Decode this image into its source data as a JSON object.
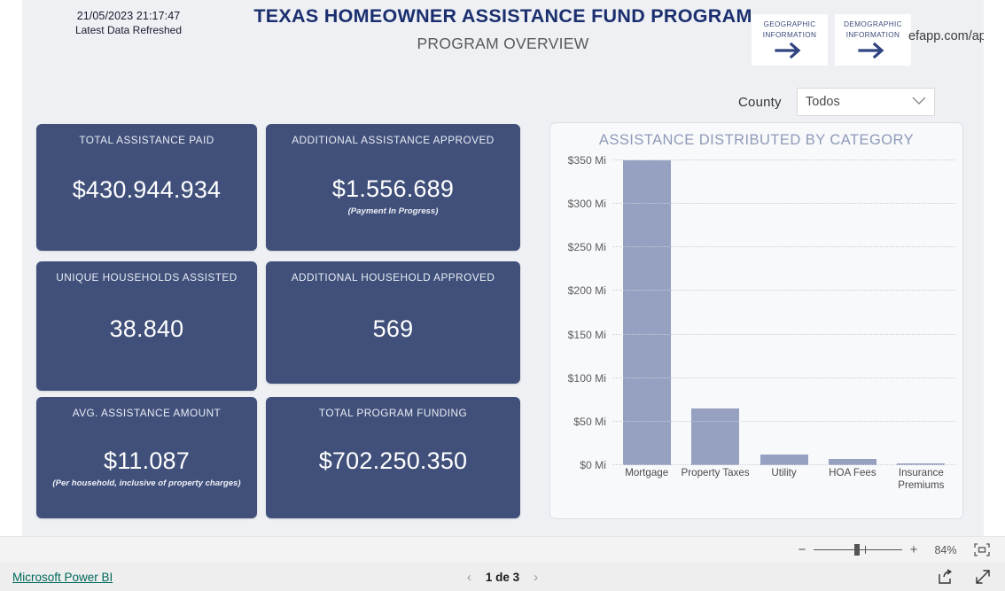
{
  "header": {
    "refresh_time": "21/05/2023 21:17:47",
    "refresh_label": "Latest Data Refreshed",
    "title": "TEXAS HOMEOWNER ASSISTANCE FUND PROGRAM",
    "subtitle": "PROGRAM OVERVIEW",
    "nav_buttons": [
      {
        "line1": "GEOGRAPHIC",
        "line2": "INFORMATION",
        "arrow": "→"
      },
      {
        "line1": "DEMOGRAPHIC",
        "line2": "INFORMATION",
        "arrow": "→"
      }
    ],
    "clipped_url": "efapp.com/ap"
  },
  "slicer": {
    "label": "County",
    "value": "Todos",
    "chevron": "⌄"
  },
  "cards": [
    {
      "title": "TOTAL ASSISTANCE PAID",
      "value": "$430.944.934",
      "note": ""
    },
    {
      "title": "ADDITIONAL ASSISTANCE APPROVED",
      "value": "$1.556.689",
      "note": "(Payment In Progress)"
    },
    {
      "title": "UNIQUE HOUSEHOLDS ASSISTED",
      "value": "38.840",
      "note": ""
    },
    {
      "title": "ADDITIONAL HOUSEHOLD APPROVED",
      "value": "569",
      "note": ""
    },
    {
      "title": "AVG. ASSISTANCE AMOUNT",
      "value": "$11.087",
      "note": "(Per household, inclusive of property charges)"
    },
    {
      "title": "TOTAL PROGRAM FUNDING",
      "value": "$702.250.350",
      "note": ""
    }
  ],
  "chart_data": {
    "type": "bar",
    "title": "ASSISTANCE DISTRIBUTED BY CATEGORY",
    "xlabel": "",
    "ylabel": "",
    "categories": [
      "Mortgage",
      "Property Taxes",
      "Utility",
      "HOA Fees",
      "Insurance Premiums"
    ],
    "values": [
      350,
      65,
      12,
      7,
      1
    ],
    "value_unit": "millions USD",
    "ylim": [
      0,
      350
    ],
    "yticks": [
      0,
      50,
      100,
      150,
      200,
      250,
      300,
      350
    ],
    "ytick_labels": [
      "$0 Mi",
      "$50 Mi",
      "$100 Mi",
      "$150 Mi",
      "$200 Mi",
      "$250 Mi",
      "$300 Mi",
      "$350 Mi"
    ],
    "grid": true,
    "legend": "none",
    "bar_color": "#96a0c0"
  },
  "zoombar": {
    "minus": "−",
    "plus": "+",
    "percent": "84%"
  },
  "footer": {
    "brand_link": "Microsoft Power BI",
    "prev_arrow": "‹",
    "page_text": "1 de 3",
    "next_arrow": "›"
  },
  "colors": {
    "card_bg": "#40507a",
    "title_navy": "#1b2f6e",
    "bar": "#96a0c0",
    "canvas_bg": "#eef0f4",
    "accent_link": "#00695c"
  }
}
